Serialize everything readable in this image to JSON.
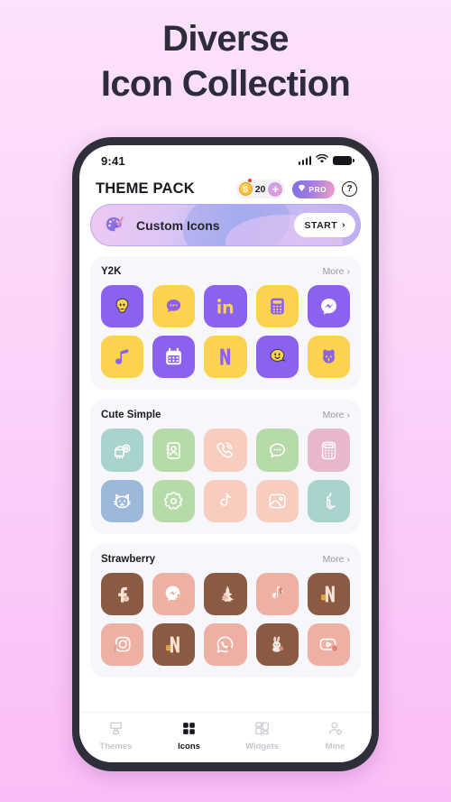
{
  "headline": {
    "line1": "Diverse",
    "line2": "Icon Collection"
  },
  "status_bar": {
    "time": "9:41",
    "signal_icon": "cellular-signal-icon",
    "wifi_icon": "wifi-icon",
    "battery_icon": "battery-icon"
  },
  "header": {
    "title": "THEME PACK",
    "coin": {
      "symbol": "S",
      "count": "20",
      "plus_label": "+",
      "icon": "coin-icon"
    },
    "pro": {
      "label": "PRO",
      "icon": "diamond-icon"
    },
    "help": {
      "label": "?",
      "icon": "help-circle-icon"
    }
  },
  "banner": {
    "icon": "palette-brush-icon",
    "label": "Custom Icons",
    "button_label": "START",
    "chevron": "›"
  },
  "sections": [
    {
      "title": "Y2K",
      "more_label": "More",
      "icons": [
        {
          "name": "y2k-ghost-face-icon",
          "bg": "#8B62F0",
          "fg": "#FBD34E"
        },
        {
          "name": "y2k-messages-icon",
          "bg": "#FBD34E",
          "fg": "#8B62F0"
        },
        {
          "name": "y2k-linkedin-icon",
          "bg": "#8B62F0",
          "fg": "#FBD34E"
        },
        {
          "name": "y2k-calculator-icon",
          "bg": "#FBD34E",
          "fg": "#8B62F0"
        },
        {
          "name": "y2k-messenger-icon",
          "bg": "#8B62F0",
          "fg": "#FFFFFF"
        },
        {
          "name": "y2k-music-icon",
          "bg": "#FBD34E",
          "fg": "#8B62F0"
        },
        {
          "name": "y2k-calendar-icon",
          "bg": "#8B62F0",
          "fg": "#FFFFFF"
        },
        {
          "name": "y2k-netflix-icon",
          "bg": "#FBD34E",
          "fg": "#8B62F0"
        },
        {
          "name": "y2k-smiley-icon",
          "bg": "#8B62F0",
          "fg": "#FBD34E"
        },
        {
          "name": "y2k-dog-icon",
          "bg": "#FBD34E",
          "fg": "#8B62F0"
        }
      ]
    },
    {
      "title": "Cute Simple",
      "more_label": "More",
      "icons": [
        {
          "name": "cute-cat-camera-icon",
          "bg": "#A9D4CD",
          "fg": "#FFFFFF"
        },
        {
          "name": "cute-contacts-icon",
          "bg": "#B7DBA8",
          "fg": "#FFFFFF"
        },
        {
          "name": "cute-phone-icon",
          "bg": "#F8CDBF",
          "fg": "#FFFFFF"
        },
        {
          "name": "cute-messages-icon",
          "bg": "#B7DBA8",
          "fg": "#FFFFFF"
        },
        {
          "name": "cute-calculator-icon",
          "bg": "#E8B7CB",
          "fg": "#FFFFFF"
        },
        {
          "name": "cute-cat-face-icon",
          "bg": "#9DB8DB",
          "fg": "#FFFFFF"
        },
        {
          "name": "cute-settings-icon",
          "bg": "#B7DBA8",
          "fg": "#FFFFFF"
        },
        {
          "name": "cute-tiktok-icon",
          "bg": "#F8CDBF",
          "fg": "#FFFFFF"
        },
        {
          "name": "cute-photos-icon",
          "bg": "#F8CDBF",
          "fg": "#FFFFFF"
        },
        {
          "name": "cute-tumblr-icon",
          "bg": "#A9D4CD",
          "fg": "#FFFFFF"
        }
      ]
    },
    {
      "title": "Strawberry",
      "more_label": "More",
      "icons": [
        {
          "name": "strawberry-facebook-icon",
          "bg": "#8A5A43",
          "fg": "#F7E3D4"
        },
        {
          "name": "strawberry-messenger-icon",
          "bg": "#EFB0A4",
          "fg": "#FFFFFF"
        },
        {
          "name": "strawberry-snapchat-icon",
          "bg": "#8A5A43",
          "fg": "#F7E3D4"
        },
        {
          "name": "strawberry-tiktok-icon",
          "bg": "#EFB0A4",
          "fg": "#FFFFFF"
        },
        {
          "name": "strawberry-netflix-icon",
          "bg": "#8A5A43",
          "fg": "#F7E3D4"
        },
        {
          "name": "strawberry-instagram-icon",
          "bg": "#EFB0A4",
          "fg": "#FFFFFF"
        },
        {
          "name": "strawberry-netflix-2-icon",
          "bg": "#8A5A43",
          "fg": "#F7E3D4"
        },
        {
          "name": "strawberry-whatsapp-icon",
          "bg": "#EFB0A4",
          "fg": "#FFFFFF"
        },
        {
          "name": "strawberry-bunny-icon",
          "bg": "#8A5A43",
          "fg": "#F7E3D4"
        },
        {
          "name": "strawberry-youtube-icon",
          "bg": "#EFB0A4",
          "fg": "#FFFFFF"
        }
      ]
    }
  ],
  "tabbar": {
    "items": [
      {
        "label": "Themes",
        "icon": "themes-icon",
        "active": false
      },
      {
        "label": "Icons",
        "icon": "icons-grid-icon",
        "active": true
      },
      {
        "label": "Widgets",
        "icon": "widgets-icon",
        "active": false
      },
      {
        "label": "Mine",
        "icon": "person-gear-icon",
        "active": false
      }
    ]
  },
  "colors": {
    "background_top": "#FCE2FB",
    "background_bottom": "#FBBDF7",
    "headline": "#2C2C3A",
    "phone_frame": "#2E2F3A",
    "card": "#F6F6FB",
    "y2k_purple": "#8B62F0",
    "y2k_yellow": "#FBD34E"
  }
}
